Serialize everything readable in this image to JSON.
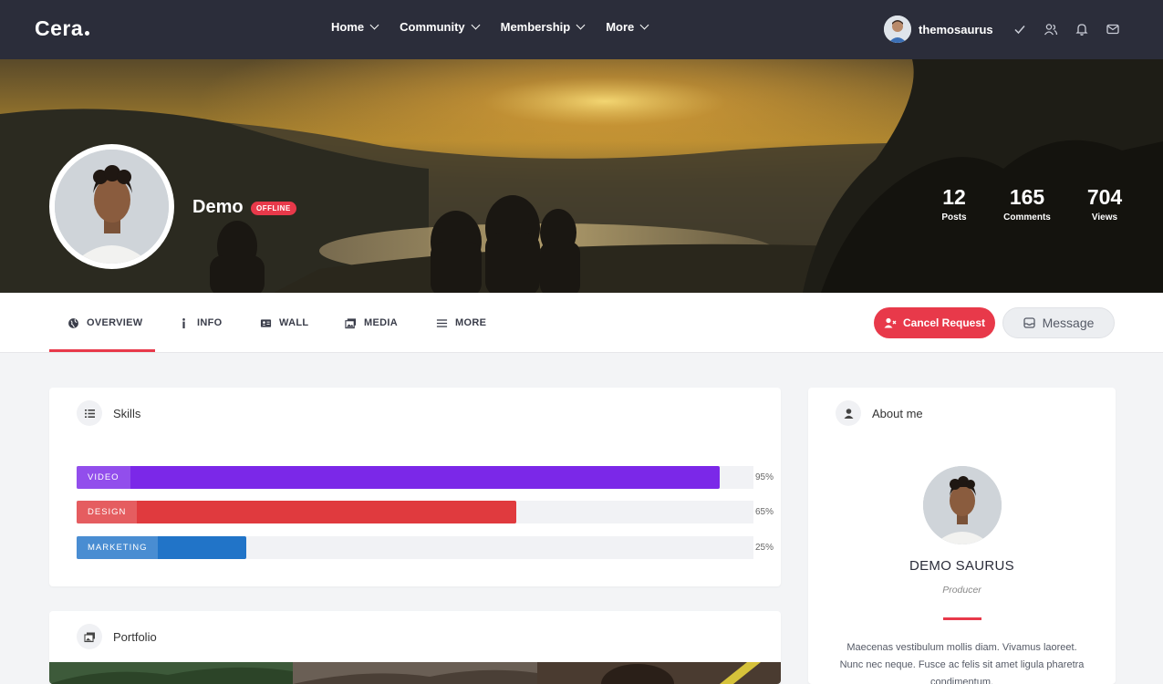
{
  "header": {
    "logo": "Cera",
    "nav": [
      {
        "label": "Home"
      },
      {
        "label": "Community"
      },
      {
        "label": "Membership"
      },
      {
        "label": "More"
      }
    ],
    "username": "themosaurus",
    "icons": [
      "check-icon",
      "users-icon",
      "bell-icon",
      "mail-icon"
    ]
  },
  "profile": {
    "name": "Demo",
    "status": "OFFLINE",
    "stats": [
      {
        "value": "12",
        "label": "Posts"
      },
      {
        "value": "165",
        "label": "Comments"
      },
      {
        "value": "704",
        "label": "Views"
      }
    ]
  },
  "tabs": [
    {
      "label": "OVERVIEW",
      "icon": "globe-icon",
      "active": true
    },
    {
      "label": "INFO",
      "icon": "info-icon"
    },
    {
      "label": "WALL",
      "icon": "id-card-icon"
    },
    {
      "label": "MEDIA",
      "icon": "images-icon"
    },
    {
      "label": "MORE",
      "icon": "menu-icon"
    }
  ],
  "actions": {
    "cancel_request": "Cancel Request",
    "message": "Message"
  },
  "skills": {
    "title": "Skills",
    "items": [
      {
        "label": "VIDEO",
        "percent": 95,
        "pct_label": "95%",
        "color": "#7b28e8"
      },
      {
        "label": "DESIGN",
        "percent": 65,
        "pct_label": "65%",
        "color": "#e03a3e"
      },
      {
        "label": "MARKETING",
        "percent": 25,
        "pct_label": "25%",
        "color": "#2174c8"
      }
    ]
  },
  "portfolio": {
    "title": "Portfolio"
  },
  "about": {
    "title": "About me",
    "name": "DEMO SAURUS",
    "role": "Producer",
    "bio": "Maecenas vestibulum mollis diam. Vivamus laoreet. Nunc nec neque. Fusce ac felis sit amet ligula pharetra condimentum."
  },
  "colors": {
    "accent": "#e8394a",
    "topbar": "#2b2d3a"
  }
}
